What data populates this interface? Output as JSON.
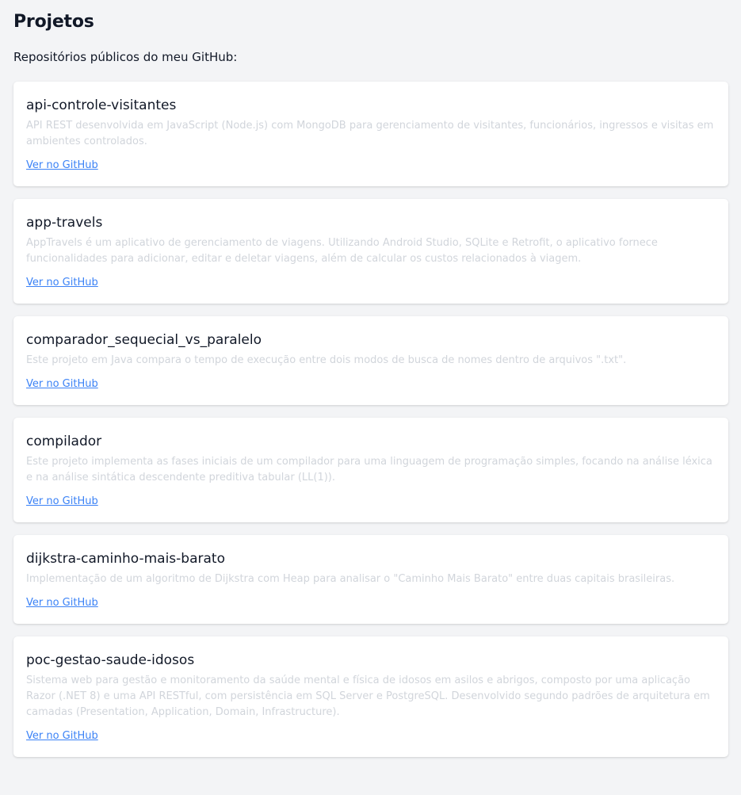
{
  "header": {
    "title": "Projetos",
    "subtitle": "Repositórios públicos do meu GitHub:"
  },
  "projects": [
    {
      "name": "api-controle-visitantes",
      "description": "API REST desenvolvida em JavaScript (Node.js) com MongoDB para gerenciamento de visitantes, funcionários, ingressos e visitas em ambientes controlados.",
      "link_label": "Ver no GitHub"
    },
    {
      "name": "app-travels",
      "description": "AppTravels é um aplicativo de gerenciamento de viagens. Utilizando Android Studio, SQLite e Retrofit, o aplicativo fornece funcionalidades para adicionar, editar e deletar viagens, além de calcular os custos relacionados à viagem.",
      "link_label": "Ver no GitHub"
    },
    {
      "name": "comparador_sequecial_vs_paralelo",
      "description": "Este projeto em Java compara o tempo de execução entre dois modos de busca de nomes dentro de arquivos \".txt\".",
      "link_label": "Ver no GitHub"
    },
    {
      "name": "compilador",
      "description": "Este projeto implementa as fases iniciais de um compilador para uma linguagem de programação simples, focando na análise léxica e na análise sintática descendente preditiva tabular (LL(1)).",
      "link_label": "Ver no GitHub"
    },
    {
      "name": "dijkstra-caminho-mais-barato",
      "description": "Implementação de um algoritmo de Dijkstra com Heap para analisar o \"Caminho Mais Barato\" entre duas capitais brasileiras.",
      "link_label": "Ver no GitHub"
    },
    {
      "name": "poc-gestao-saude-idosos",
      "description": "Sistema web para gestão e monitoramento da saúde mental e física de idosos em asilos e abrigos, composto por uma aplicação Razor (.NET 8) e uma API RESTful, com persistência em SQL Server e PostgreSQL. Desenvolvido segundo padrões de arquitetura em camadas (Presentation, Application, Domain, Infrastructure).",
      "link_label": "Ver no GitHub"
    }
  ],
  "colors": {
    "background": "#f3f4f6",
    "card": "#ffffff",
    "title_text": "#111827",
    "description_text": "#d1d5db",
    "link": "#3b82f6"
  }
}
